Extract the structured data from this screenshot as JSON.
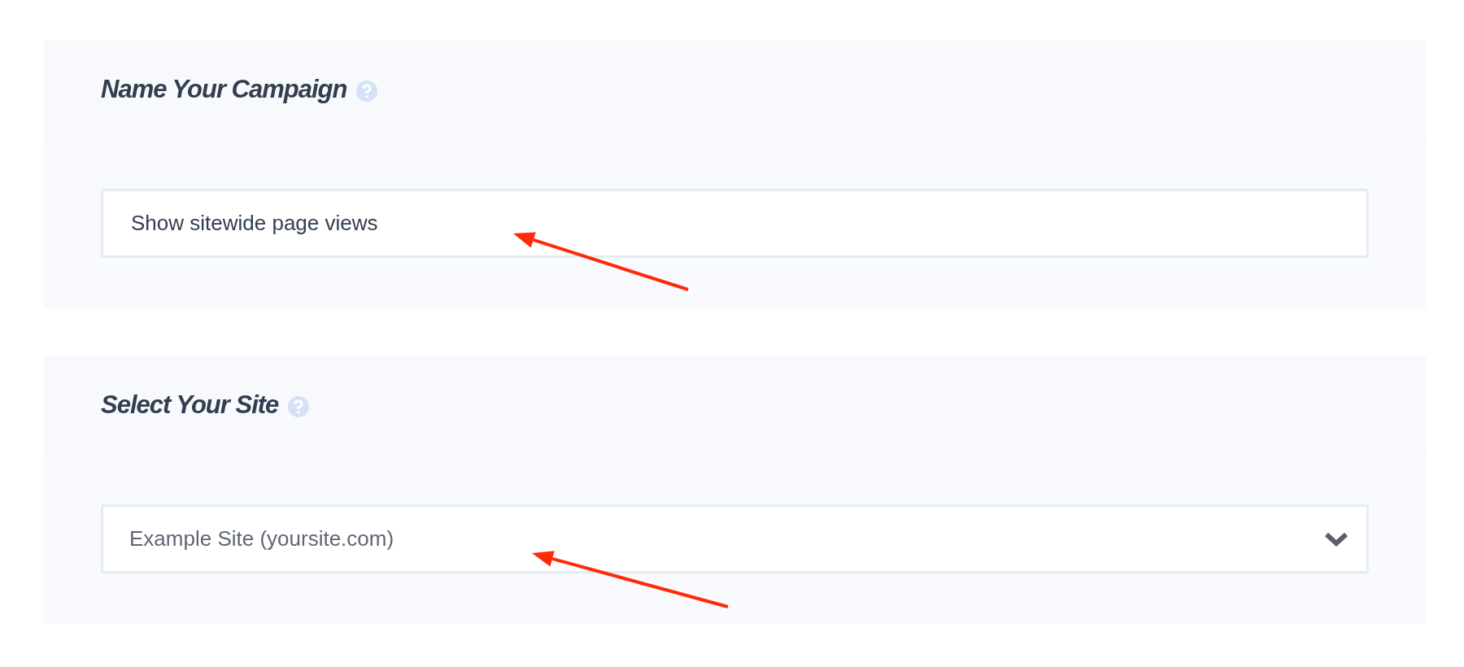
{
  "sections": [
    {
      "title": "Name Your Campaign",
      "field": {
        "kind": "text",
        "value": "Show sitewide page views"
      }
    },
    {
      "title": "Select Your Site",
      "field": {
        "kind": "select",
        "value": "Example Site (yoursite.com)"
      }
    }
  ]
}
